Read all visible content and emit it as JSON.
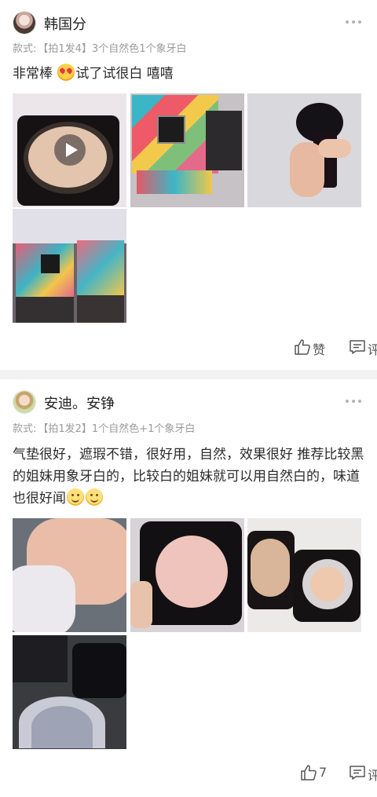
{
  "reviews": [
    {
      "username": "韩国分",
      "spec_label": "款式:",
      "spec_value": "【拍1发4】3个自然色1个象牙白",
      "text_before_emoji": "非常棒 ",
      "text_after_emoji": "试了试很白 嘻嘻",
      "like_label": "赞",
      "comment_label": "评论",
      "photo_icons": [
        "play-icon"
      ]
    },
    {
      "username": "安迪。安铮",
      "spec_label": "款式:",
      "spec_value": "【拍1发2】1个自然色+1个象牙白",
      "text": "气垫很好，遮瑕不错，很好用，自然，效果很好 推荐比较黑的姐妹用象牙白的，比较白的姐妹就可以用自然白的，味道也很好闻",
      "like_label": "7",
      "comment_label": "评论"
    }
  ],
  "colors": {
    "page_bg": "#f2f2f2",
    "card_bg": "#ffffff",
    "muted_text": "#9a9a9a"
  }
}
